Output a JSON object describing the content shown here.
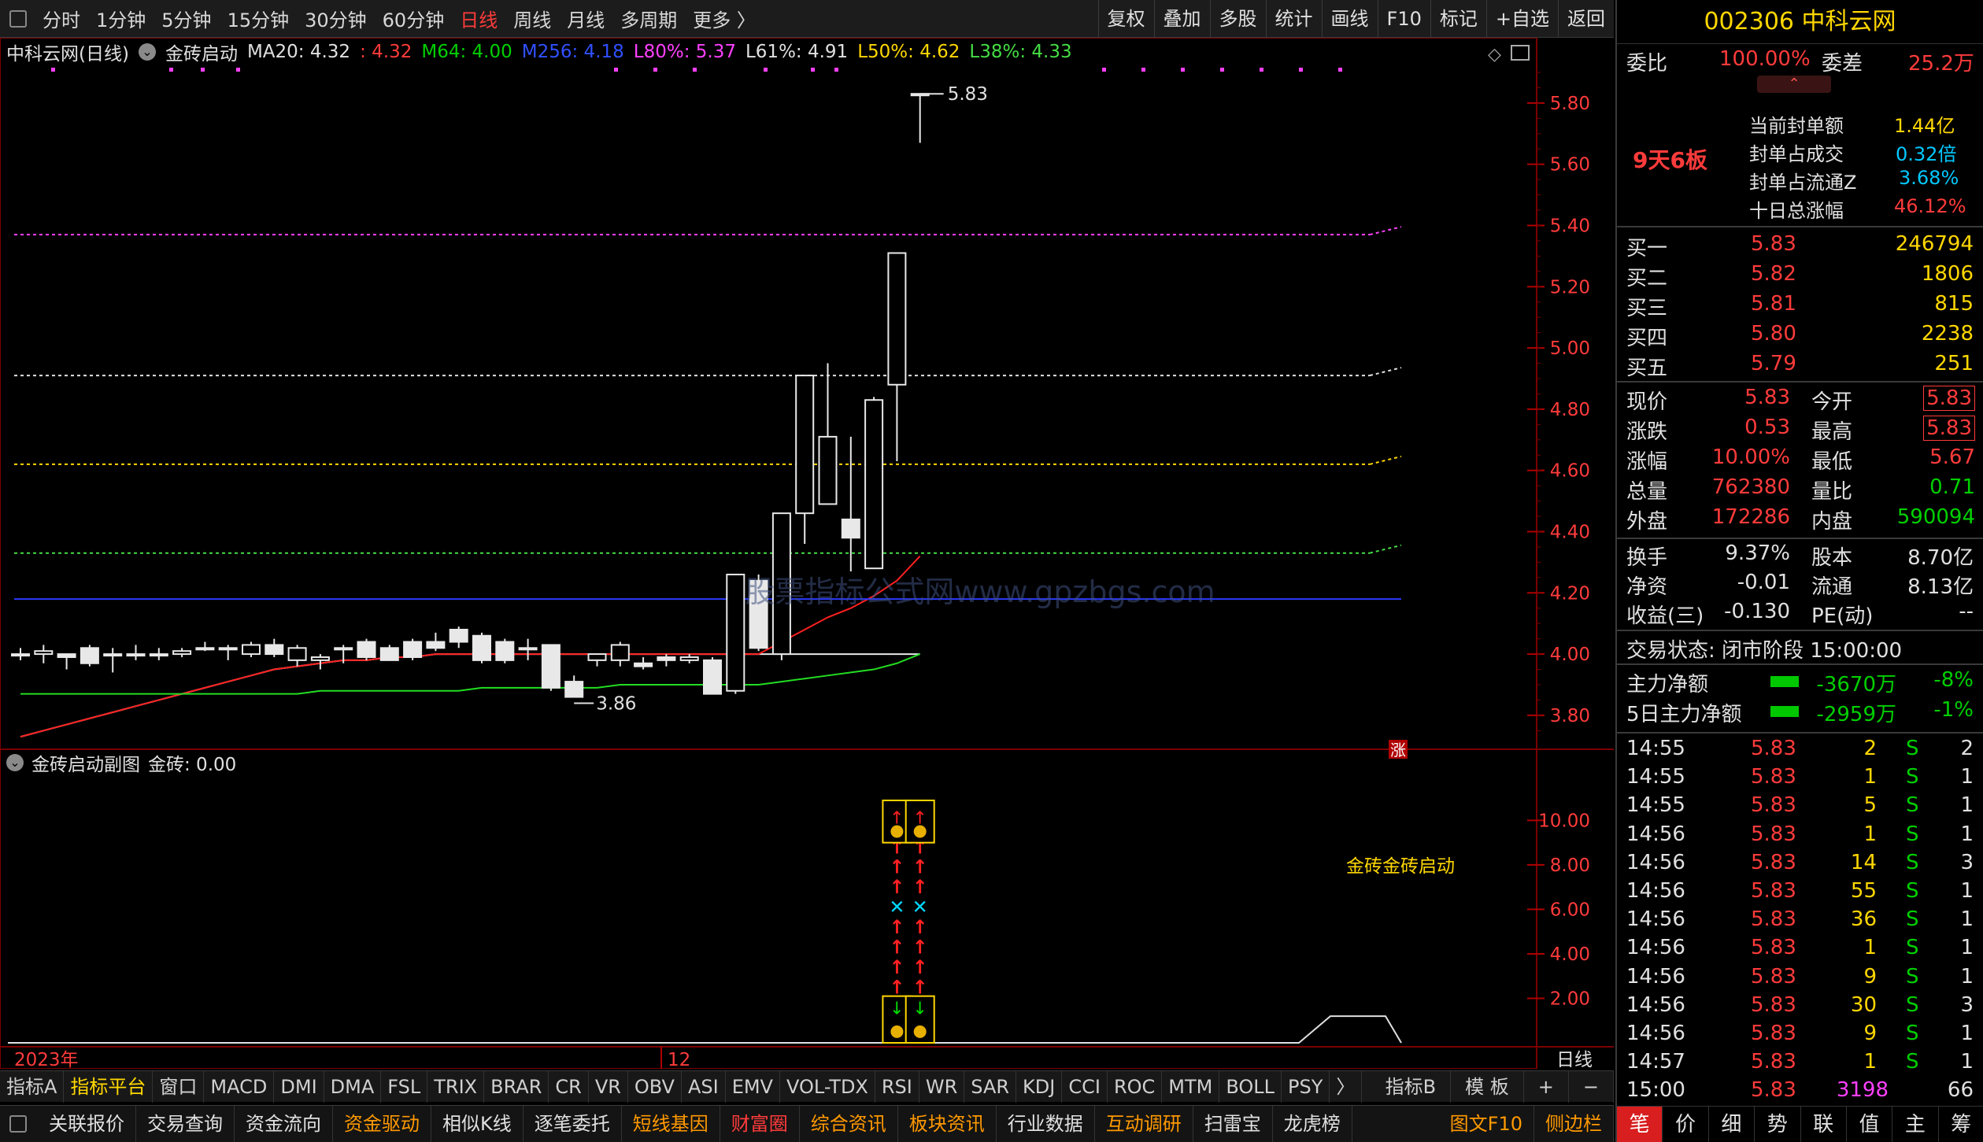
{
  "toolbar": {
    "periods": [
      "分时",
      "1分钟",
      "5分钟",
      "15分钟",
      "30分钟",
      "60分钟",
      "日线",
      "周线",
      "月线",
      "多周期",
      "更多 〉"
    ],
    "active_period": "日线",
    "right_buttons": [
      "复权",
      "叠加",
      "多股",
      "统计",
      "画线",
      "F10",
      "标记",
      "+自选",
      "返回"
    ]
  },
  "legend": {
    "name": "中科云网(日线)",
    "indicator": "金砖启动",
    "ma20": "MA20: 4.32",
    "val1": ": 4.32",
    "m64": "M64: 4.00",
    "m256": "M256: 4.18",
    "l80": "L80%: 5.37",
    "l61": "L61%: 4.91",
    "l50": "L50%: 4.62",
    "l38": "L38%: 4.33"
  },
  "sub_legend": {
    "name": "金砖启动副图",
    "value": "金砖: 0.00"
  },
  "sub_annot": "金砖金砖启动",
  "zt_badge": "涨",
  "colors": {
    "up": "#ff3b3b",
    "down": "#00d000",
    "bg": "#000000",
    "grid": "#8b0000"
  },
  "chart_data": {
    "type": "candlestick",
    "ylim": [
      3.72,
      5.9
    ],
    "yticks": [
      "5.80",
      "5.60",
      "5.40",
      "5.20",
      "5.00",
      "4.80",
      "4.60",
      "4.40",
      "4.20",
      "4.00",
      "3.80"
    ],
    "sub_yticks": [
      "10.00",
      "8.00",
      "6.00",
      "4.00",
      "2.00"
    ],
    "x_labels": [
      "2023年",
      "12"
    ],
    "period_label": "日线",
    "high_label": "5.83",
    "low_label": "3.86",
    "candles": [
      [
        4.0,
        4.0,
        4.02,
        3.98
      ],
      [
        4.0,
        4.01,
        4.03,
        3.97
      ],
      [
        4.0,
        3.99,
        4.0,
        3.95
      ],
      [
        4.02,
        3.97,
        4.03,
        3.96
      ],
      [
        4.0,
        4.0,
        4.02,
        3.94
      ],
      [
        4.0,
        4.0,
        4.03,
        3.98
      ],
      [
        4.0,
        4.0,
        4.02,
        3.98
      ],
      [
        4.0,
        4.01,
        4.02,
        3.99
      ],
      [
        4.02,
        4.02,
        4.04,
        4.01
      ],
      [
        4.02,
        4.02,
        4.03,
        3.98
      ],
      [
        4.0,
        4.03,
        4.04,
        3.99
      ],
      [
        4.03,
        4.0,
        4.05,
        3.99
      ],
      [
        3.98,
        4.02,
        4.03,
        3.96
      ],
      [
        3.98,
        3.99,
        4.0,
        3.95
      ],
      [
        4.02,
        4.02,
        4.03,
        3.97
      ],
      [
        4.04,
        3.99,
        4.05,
        3.98
      ],
      [
        4.02,
        3.98,
        4.03,
        3.98
      ],
      [
        4.04,
        3.99,
        4.05,
        3.98
      ],
      [
        4.04,
        4.02,
        4.07,
        4.01
      ],
      [
        4.08,
        4.04,
        4.09,
        4.02
      ],
      [
        4.06,
        3.98,
        4.07,
        3.97
      ],
      [
        4.04,
        3.98,
        4.05,
        3.97
      ],
      [
        4.02,
        4.02,
        4.05,
        3.98
      ],
      [
        4.03,
        3.89,
        4.03,
        3.88
      ],
      [
        3.91,
        3.86,
        3.93,
        3.86
      ],
      [
        3.98,
        4.0,
        4.0,
        3.96
      ],
      [
        3.98,
        4.03,
        4.04,
        3.96
      ],
      [
        3.97,
        3.96,
        3.99,
        3.95
      ],
      [
        3.99,
        3.98,
        4.0,
        3.96
      ],
      [
        3.98,
        3.99,
        4.0,
        3.97
      ],
      [
        3.98,
        3.87,
        3.99,
        3.87
      ],
      [
        3.88,
        4.26,
        4.26,
        3.87
      ],
      [
        4.24,
        4.02,
        4.26,
        4.01
      ],
      [
        4.0,
        4.46,
        4.46,
        3.98
      ],
      [
        4.46,
        4.91,
        4.91,
        4.36
      ],
      [
        4.49,
        4.71,
        4.95,
        4.49
      ],
      [
        4.44,
        4.38,
        4.71,
        4.27
      ],
      [
        4.28,
        4.83,
        4.84,
        4.28
      ],
      [
        4.88,
        5.31,
        5.31,
        4.63
      ],
      [
        5.83,
        5.83,
        5.83,
        5.67
      ]
    ],
    "ma_white": [
      3.73,
      3.75,
      3.77,
      3.79,
      3.81,
      3.83,
      3.85,
      3.87,
      3.89,
      3.91,
      3.93,
      3.95,
      3.96,
      3.97,
      3.98,
      3.98,
      3.99,
      3.99,
      4.0,
      4.0,
      4.0,
      4.0,
      4.0,
      4.0,
      4.0,
      4.0,
      4.0,
      4.0,
      4.0,
      4.0,
      4.0,
      4.0,
      4.0,
      4.0,
      4.0,
      4.0,
      4.0,
      4.0,
      4.0,
      4.0
    ],
    "ma_red": [
      3.73,
      3.75,
      3.77,
      3.79,
      3.81,
      3.83,
      3.85,
      3.87,
      3.89,
      3.91,
      3.93,
      3.95,
      3.96,
      3.97,
      3.98,
      3.98,
      3.99,
      3.99,
      4.0,
      4.0,
      4.0,
      4.0,
      4.0,
      4.0,
      4.0,
      4.0,
      4.0,
      4.0,
      4.0,
      4.0,
      4.0,
      4.0,
      4.0,
      4.04,
      4.08,
      4.12,
      4.15,
      4.19,
      4.24,
      4.32
    ],
    "ma_green": [
      3.87,
      3.87,
      3.87,
      3.87,
      3.87,
      3.87,
      3.87,
      3.87,
      3.87,
      3.87,
      3.87,
      3.87,
      3.87,
      3.88,
      3.88,
      3.88,
      3.88,
      3.88,
      3.88,
      3.88,
      3.89,
      3.89,
      3.89,
      3.89,
      3.89,
      3.89,
      3.9,
      3.9,
      3.9,
      3.9,
      3.9,
      3.9,
      3.9,
      3.91,
      3.92,
      3.93,
      3.94,
      3.95,
      3.97,
      4.0
    ],
    "ma_blue": 4.18,
    "levels": [
      {
        "name": "L80%",
        "value": 5.37,
        "color": "#ff40ff"
      },
      {
        "name": "L61%",
        "value": 4.91,
        "color": "#e0e0e0"
      },
      {
        "name": "L50%",
        "value": 4.62,
        "color": "#ffd700"
      },
      {
        "name": "L38%",
        "value": 4.33,
        "color": "#44dd44"
      }
    ],
    "signal_bars": [
      38,
      39
    ]
  },
  "panel": {
    "code": "002306 中科云网",
    "weibi_label": "委比",
    "weibi": "100.00%",
    "weicha_label": "委差",
    "weicha": "25.2万",
    "board": "9天6板",
    "seal": [
      {
        "label": "当前封单额",
        "value": "1.44亿"
      },
      {
        "label": "封单占成交",
        "value": "0.32倍"
      },
      {
        "label": "封单占流通Z",
        "value": "3.68%"
      },
      {
        "label": "十日总涨幅",
        "value": "46.12%"
      }
    ],
    "bids": [
      {
        "label": "买一",
        "price": "5.83",
        "vol": "246794"
      },
      {
        "label": "买二",
        "price": "5.82",
        "vol": "1806"
      },
      {
        "label": "买三",
        "price": "5.81",
        "vol": "815"
      },
      {
        "label": "买四",
        "price": "5.80",
        "vol": "2238"
      },
      {
        "label": "买五",
        "price": "5.79",
        "vol": "251"
      }
    ],
    "stats": [
      {
        "l1": "现价",
        "v1": "5.83",
        "c1": "red",
        "l2": "今开",
        "v2": "5.83",
        "c2": "red"
      },
      {
        "l1": "涨跌",
        "v1": "0.53",
        "c1": "red",
        "l2": "最高",
        "v2": "5.83",
        "c2": "red"
      },
      {
        "l1": "涨幅",
        "v1": "10.00%",
        "c1": "red",
        "l2": "最低",
        "v2": "5.67",
        "c2": "red"
      },
      {
        "l1": "总量",
        "v1": "762380",
        "c1": "red",
        "l2": "量比",
        "v2": "0.71",
        "c2": "green"
      },
      {
        "l1": "外盘",
        "v1": "172286",
        "c1": "red",
        "l2": "内盘",
        "v2": "590094",
        "c2": "green"
      }
    ],
    "stats2": [
      {
        "l1": "换手",
        "v1": "9.37%",
        "l2": "股本",
        "v2": "8.70亿"
      },
      {
        "l1": "净资",
        "v1": "-0.01",
        "l2": "流通",
        "v2": "8.13亿"
      },
      {
        "l1": "收益(三)",
        "v1": "-0.130",
        "l2": "PE(动)",
        "v2": "--"
      }
    ],
    "status": "交易状态: 闭市阶段 15:00:00",
    "flows": [
      {
        "label": "主力净额",
        "value": "-3670万",
        "pct": "-8%"
      },
      {
        "label": "5日主力净额",
        "value": "-2959万",
        "pct": "-1%"
      }
    ],
    "ticks": [
      [
        "14:55",
        "5.83",
        "2",
        "S",
        "2"
      ],
      [
        "14:55",
        "5.83",
        "1",
        "S",
        "1"
      ],
      [
        "14:55",
        "5.83",
        "5",
        "S",
        "1"
      ],
      [
        "14:56",
        "5.83",
        "1",
        "S",
        "1"
      ],
      [
        "14:56",
        "5.83",
        "14",
        "S",
        "3"
      ],
      [
        "14:56",
        "5.83",
        "55",
        "S",
        "1"
      ],
      [
        "14:56",
        "5.83",
        "36",
        "S",
        "1"
      ],
      [
        "14:56",
        "5.83",
        "1",
        "S",
        "1"
      ],
      [
        "14:56",
        "5.83",
        "9",
        "S",
        "1"
      ],
      [
        "14:56",
        "5.83",
        "30",
        "S",
        "3"
      ],
      [
        "14:56",
        "5.83",
        "9",
        "S",
        "1"
      ],
      [
        "14:57",
        "5.83",
        "1",
        "S",
        "1"
      ],
      [
        "15:00",
        "5.83",
        "3198",
        "",
        "66"
      ]
    ],
    "bottom_tabs": [
      "笔",
      "价",
      "细",
      "势",
      "联",
      "值",
      "主",
      "筹"
    ],
    "active_tab": "笔"
  },
  "indicator_tabs": [
    "指标A",
    "指标平台",
    "窗口",
    "MACD",
    "DMI",
    "DMA",
    "FSL",
    "TRIX",
    "BRAR",
    "CR",
    "VR",
    "OBV",
    "ASI",
    "EMV",
    "VOL-TDX",
    "RSI",
    "WR",
    "SAR",
    "KDJ",
    "CCI",
    "ROC",
    "MTM",
    "BOLL",
    "PSY",
    "〉"
  ],
  "indicator_right": [
    "指标B",
    "模 板",
    "+",
    "−"
  ],
  "func_tabs": [
    {
      "label": "关联报价",
      "color": "#e0e0e0"
    },
    {
      "label": "交易查询",
      "color": "#e0e0e0"
    },
    {
      "label": "资金流向",
      "color": "#e0e0e0"
    },
    {
      "label": "资金驱动",
      "color": "#ff9900"
    },
    {
      "label": "相似K线",
      "color": "#e0e0e0"
    },
    {
      "label": "逐笔委托",
      "color": "#e0e0e0"
    },
    {
      "label": "短线基因",
      "color": "#ff9900"
    },
    {
      "label": "财富圈",
      "color": "#ff3b3b"
    },
    {
      "label": "综合资讯",
      "color": "#ff9900"
    },
    {
      "label": "板块资讯",
      "color": "#ff9900"
    },
    {
      "label": "行业数据",
      "color": "#e0e0e0"
    },
    {
      "label": "互动调研",
      "color": "#ff9900"
    },
    {
      "label": "扫雷宝",
      "color": "#e0e0e0"
    },
    {
      "label": "龙虎榜",
      "color": "#e0e0e0"
    }
  ],
  "func_right": [
    {
      "label": "图文F10",
      "color": "#ff9900"
    },
    {
      "label": "侧边栏",
      "color": "#ff9900"
    }
  ],
  "watermark": "股票指标公式网www.gpzbgs.com"
}
